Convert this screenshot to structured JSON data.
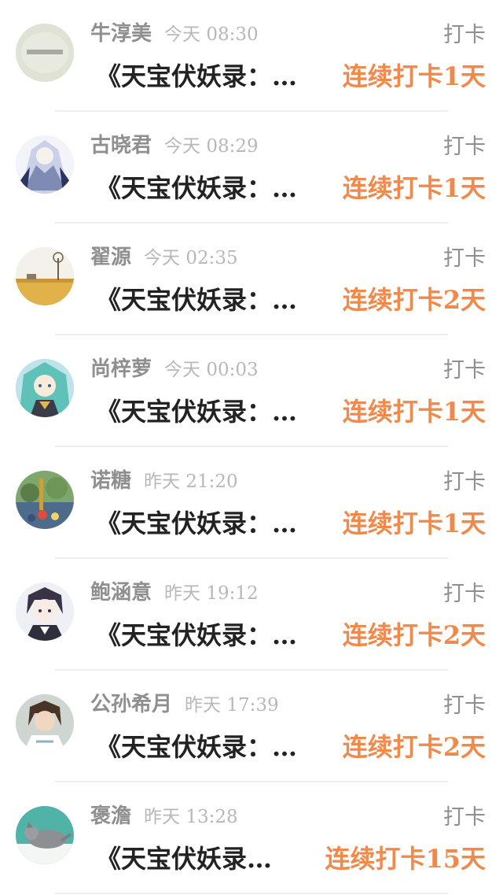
{
  "entries": [
    {
      "name": "牛淳美",
      "time": "今天 08:30",
      "action": "打卡",
      "book": "《天宝伏妖录：…",
      "streak": "连续打卡1天",
      "avatar": "avatar-1"
    },
    {
      "name": "古晓君",
      "time": "今天 08:29",
      "action": "打卡",
      "book": "《天宝伏妖录：…",
      "streak": "连续打卡1天",
      "avatar": "avatar-2"
    },
    {
      "name": "翟源",
      "time": "今天 02:35",
      "action": "打卡",
      "book": "《天宝伏妖录：…",
      "streak": "连续打卡2天",
      "avatar": "avatar-3"
    },
    {
      "name": "尚梓萝",
      "time": "今天 00:03",
      "action": "打卡",
      "book": "《天宝伏妖录：…",
      "streak": "连续打卡1天",
      "avatar": "avatar-4"
    },
    {
      "name": "诺糖",
      "time": "昨天 21:20",
      "action": "打卡",
      "book": "《天宝伏妖录：…",
      "streak": "连续打卡1天",
      "avatar": "avatar-5"
    },
    {
      "name": "鲍涵意",
      "time": "昨天 19:12",
      "action": "打卡",
      "book": "《天宝伏妖录：…",
      "streak": "连续打卡2天",
      "avatar": "avatar-6"
    },
    {
      "name": "公孙希月",
      "time": "昨天 17:39",
      "action": "打卡",
      "book": "《天宝伏妖录：…",
      "streak": "连续打卡2天",
      "avatar": "avatar-7"
    },
    {
      "name": "褒澹",
      "time": "昨天 13:28",
      "action": "打卡",
      "book": "《天宝伏妖录…",
      "streak": "连续打卡15天",
      "avatar": "avatar-8"
    }
  ],
  "colors": {
    "streak": "#f08a4b",
    "name": "#8f8f8f",
    "time": "#b8b8b8",
    "book": "#222222"
  }
}
